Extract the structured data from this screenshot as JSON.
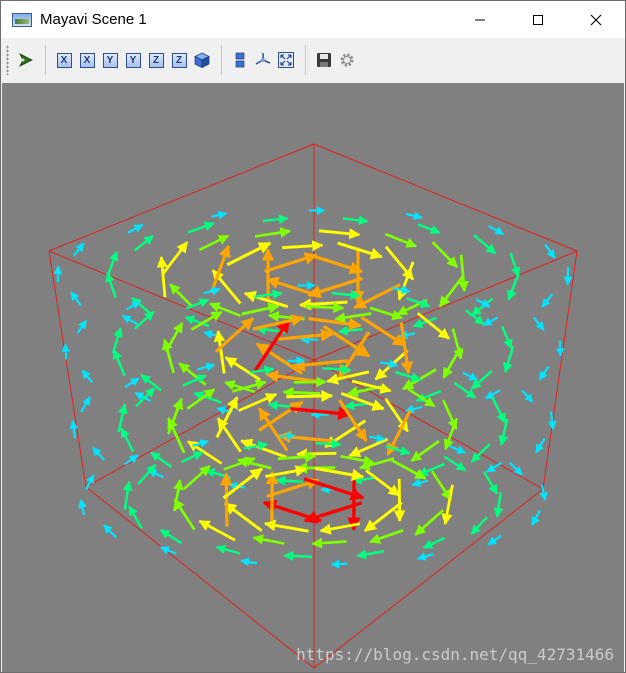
{
  "window": {
    "title": "Mayavi Scene 1",
    "controls": [
      {
        "name": "minimize-button",
        "icon": "minimize-icon"
      },
      {
        "name": "maximize-button",
        "icon": "maximize-icon"
      },
      {
        "name": "close-button",
        "icon": "close-icon"
      }
    ]
  },
  "toolbar": {
    "pipeline": {
      "icon": "pipeline-icon"
    },
    "view_buttons": [
      {
        "name": "view-plus-x-button",
        "label": "X",
        "icon": "view-x-positive-icon"
      },
      {
        "name": "view-minus-x-button",
        "label": "X",
        "icon": "view-x-negative-icon"
      },
      {
        "name": "view-plus-y-button",
        "label": "Y",
        "icon": "view-y-positive-icon"
      },
      {
        "name": "view-minus-y-button",
        "label": "Y",
        "icon": "view-y-negative-icon"
      },
      {
        "name": "view-plus-z-button",
        "label": "Z",
        "icon": "view-z-positive-icon"
      },
      {
        "name": "view-minus-z-button",
        "label": "Z",
        "icon": "view-z-negative-icon"
      },
      {
        "name": "isometric-view-button",
        "label": "",
        "icon": "isometric-cube-icon"
      }
    ],
    "tools": [
      {
        "name": "parallel-projection-button",
        "icon": "parallel-projection-icon"
      },
      {
        "name": "axes-indicator-button",
        "icon": "axes-indicator-icon"
      },
      {
        "name": "full-screen-button",
        "icon": "full-screen-icon"
      }
    ],
    "file": [
      {
        "name": "save-button",
        "icon": "save-icon"
      },
      {
        "name": "configure-button",
        "icon": "gear-icon"
      }
    ]
  },
  "scene": {
    "background": "#808080",
    "outline_color": "#e02020",
    "colormap": [
      "#00e5ff",
      "#00ff80",
      "#80ff00",
      "#ffff00",
      "#ffa500",
      "#ff0000"
    ],
    "watermark": "https://blog.csdn.net/qq_42731466"
  }
}
